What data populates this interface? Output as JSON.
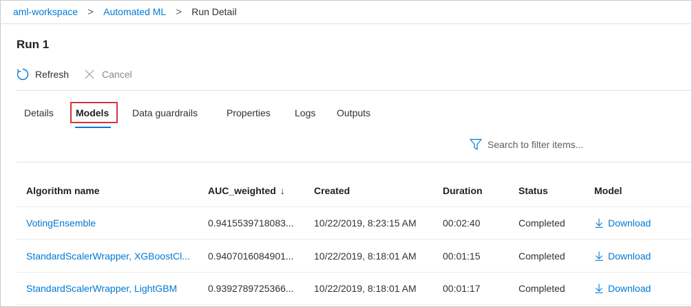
{
  "breadcrumb": {
    "items": [
      "aml-workspace",
      "Automated ML"
    ],
    "current": "Run Detail",
    "separator": ">"
  },
  "page": {
    "title": "Run 1"
  },
  "commands": {
    "refresh": {
      "label": "Refresh",
      "icon": "refresh-icon"
    },
    "cancel": {
      "label": "Cancel",
      "icon": "close-icon",
      "disabled": true
    }
  },
  "tabs": [
    {
      "label": "Details"
    },
    {
      "label": "Models",
      "active": true
    },
    {
      "label": "Data guardrails"
    },
    {
      "label": "Properties"
    },
    {
      "label": "Logs"
    },
    {
      "label": "Outputs"
    }
  ],
  "filter": {
    "placeholder": "Search to filter items...",
    "icon": "filter-icon"
  },
  "table": {
    "columns": [
      "Algorithm name",
      "AUC_weighted",
      "Created",
      "Duration",
      "Status",
      "Model"
    ],
    "sort_indicator": "↓",
    "rows": [
      {
        "algorithm": "VotingEnsemble",
        "auc": "0.9415539718083...",
        "created": "10/22/2019, 8:23:15 AM",
        "duration": "00:02:40",
        "status": "Completed",
        "model": "Download"
      },
      {
        "algorithm": "StandardScalerWrapper, XGBoostCl...",
        "auc": "0.9407016084901...",
        "created": "10/22/2019, 8:18:01 AM",
        "duration": "00:01:15",
        "status": "Completed",
        "model": "Download"
      },
      {
        "algorithm": "StandardScalerWrapper, LightGBM",
        "auc": "0.9392789725366...",
        "created": "10/22/2019, 8:18:01 AM",
        "duration": "00:01:17",
        "status": "Completed",
        "model": "Download"
      }
    ]
  },
  "colors": {
    "accent": "#0078d4",
    "highlight": "#d13438"
  }
}
